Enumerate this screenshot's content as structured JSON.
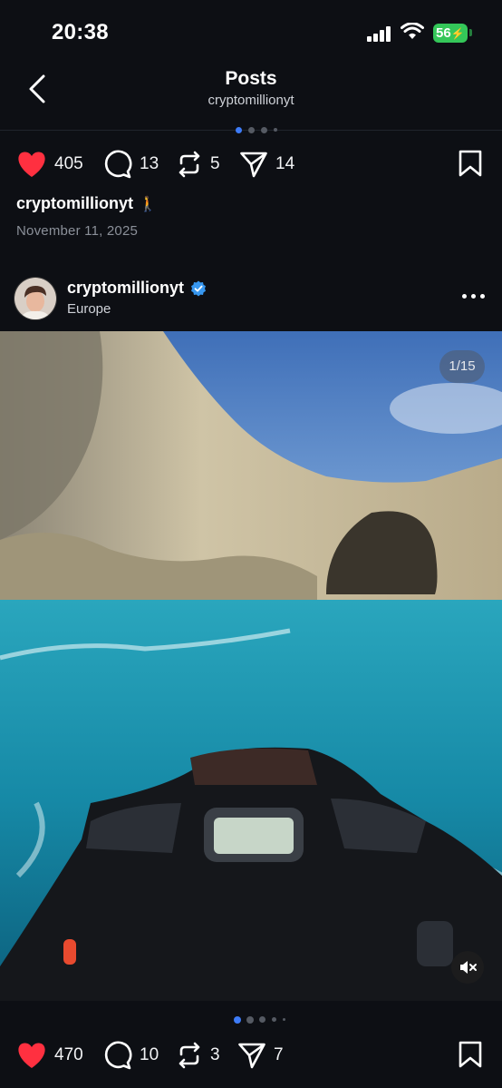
{
  "status_bar": {
    "time": "20:38",
    "battery": "56"
  },
  "nav": {
    "title": "Posts",
    "subtitle": "cryptomillionyt"
  },
  "prev_post": {
    "likes": "405",
    "comments": "13",
    "reposts": "5",
    "shares": "14",
    "caption_user": "cryptomillionyt",
    "caption_emoji": "🚶",
    "date": "November 11, 2025"
  },
  "post": {
    "username": "cryptomillionyt",
    "location": "Europe",
    "image_counter": "1/15",
    "likes": "470",
    "comments": "10",
    "reposts": "3",
    "shares": "7"
  },
  "colors": {
    "like_red": "#ff3040",
    "verified_blue": "#3797f0",
    "background": "#0d0f14",
    "active_dot": "#3d7bf7"
  },
  "icons": [
    "back-chevron-icon",
    "heart-icon",
    "comment-icon",
    "repost-icon",
    "share-icon",
    "bookmark-icon",
    "verified-icon",
    "more-icon",
    "mute-icon",
    "signal-icon",
    "wifi-icon"
  ]
}
